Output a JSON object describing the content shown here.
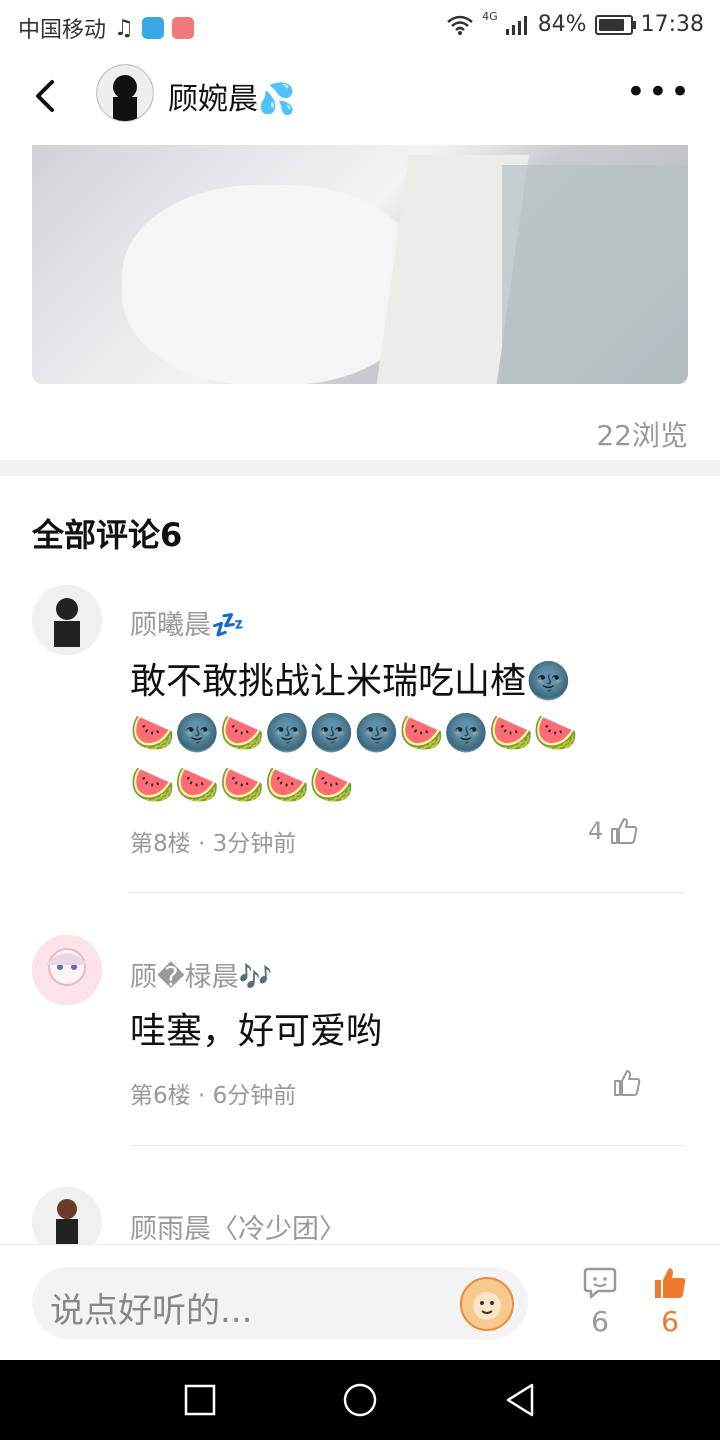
{
  "status_bar": {
    "carrier": "中国移动",
    "network": "4G",
    "battery": "84%",
    "battery_level": 0.84,
    "time": "17:38"
  },
  "header": {
    "username": "顾婉晨💦",
    "more_label": "•••"
  },
  "post": {
    "views": "22浏览"
  },
  "comments_section": {
    "title": "全部评论6"
  },
  "comments": [
    {
      "name": "顾曦晨💤",
      "text": "敢不敢挑战让米瑞吃山楂",
      "meta": "第8楼 · 3分钟前",
      "likes": "4"
    },
    {
      "name": "顾�椂晨🎶",
      "text": "哇塞，好可爱哟",
      "meta": "第6楼 · 6分钟前",
      "likes": ""
    },
    {
      "name": "顾雨晨〈冷少团〉"
    }
  ],
  "bottom_bar": {
    "input_placeholder": "说点好听的...",
    "comment_count": "6",
    "like_count": "6",
    "accent_color": "#f07a2b"
  },
  "icons": [
    "back-arrow-icon",
    "more-icon",
    "thumb-up-icon",
    "comment-icon",
    "monkey-emoji-icon",
    "nav-square-icon",
    "nav-circle-icon",
    "nav-triangle-icon"
  ]
}
